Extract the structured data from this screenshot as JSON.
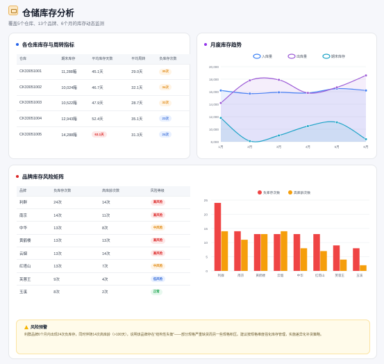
{
  "header": {
    "title": "仓储库存分析",
    "subtitle": "覆盖5个仓库、13个品牌、6个月的库存动态监测"
  },
  "warehouse_card": {
    "title": "各仓库库存与周转指标",
    "dot_color": "#2563eb",
    "columns": [
      "仓库",
      "期末库存",
      "平均库存天数",
      "平均周转",
      "负库存次数"
    ],
    "rows": [
      {
        "name": "CK33051001",
        "stock": "11,288箱",
        "days": "45.1天",
        "turn": "29.0天",
        "neg": "30次",
        "neg_style": "orange",
        "days_hl": false
      },
      {
        "name": "CK33051002",
        "stock": "10,024箱",
        "days": "46.7天",
        "turn": "32.1天",
        "neg": "34次",
        "neg_style": "orange",
        "days_hl": false
      },
      {
        "name": "CK33051003",
        "stock": "10,522箱",
        "days": "47.9天",
        "turn": "28.7天",
        "neg": "32次",
        "neg_style": "orange",
        "days_hl": false
      },
      {
        "name": "CK33051004",
        "stock": "12,943箱",
        "days": "52.4天",
        "turn": "35.1天",
        "neg": "23次",
        "neg_style": "blue",
        "days_hl": false
      },
      {
        "name": "CK33051005",
        "stock": "14,288箱",
        "days": "63.1天",
        "turn": "31.3天",
        "neg": "24次",
        "neg_style": "blue",
        "days_hl": true
      }
    ]
  },
  "trend_card": {
    "title": "月度库存趋势",
    "dot_color": "#9333ea",
    "chart_data": {
      "type": "line",
      "x": [
        "1月",
        "2月",
        "3月",
        "4月",
        "5月",
        "6月"
      ],
      "ylim": [
        8000,
        20000
      ],
      "yticks": [
        "20,000",
        "18,000",
        "16,000",
        "14,000",
        "12,000",
        "10,000",
        "8,000"
      ],
      "legend_position": "top",
      "series": [
        {
          "name": "入库量",
          "values": [
            16200,
            15700,
            15900,
            15800,
            16500,
            16200
          ],
          "color": "#3b82f6"
        },
        {
          "name": "出库量",
          "values": [
            14200,
            17800,
            17900,
            15800,
            16700,
            18600
          ],
          "color": "#9b59d6"
        },
        {
          "name": "期末库存",
          "values": [
            11800,
            8100,
            9000,
            10500,
            11100,
            8400
          ],
          "color": "#1aa3c6"
        }
      ]
    }
  },
  "brand_card": {
    "title": "品牌库存风险矩阵",
    "dot_color": "#dc2626",
    "columns": [
      "品牌",
      "负库存次数",
      "高库龄次数",
      "风险等级"
    ],
    "rows": [
      {
        "name": "利群",
        "neg": "24次",
        "age": "14次",
        "risk": "高风险",
        "risk_style": "red"
      },
      {
        "name": "南京",
        "neg": "14次",
        "age": "11次",
        "risk": "高风险",
        "risk_style": "red"
      },
      {
        "name": "中华",
        "neg": "13次",
        "age": "8次",
        "risk": "中风险",
        "risk_style": "orange"
      },
      {
        "name": "黄鹤楼",
        "neg": "13次",
        "age": "13次",
        "risk": "高风险",
        "risk_style": "red"
      },
      {
        "name": "云烟",
        "neg": "13次",
        "age": "14次",
        "risk": "高风险",
        "risk_style": "red"
      },
      {
        "name": "红塔山",
        "neg": "13次",
        "age": "7次",
        "risk": "中风险",
        "risk_style": "orange"
      },
      {
        "name": "芙蓉王",
        "neg": "9次",
        "age": "4次",
        "risk": "低风险",
        "risk_style": "blue"
      },
      {
        "name": "玉溪",
        "neg": "8次",
        "age": "2次",
        "risk": "正常",
        "risk_style": "green"
      }
    ],
    "chart_data": {
      "type": "bar",
      "categories": [
        "利群",
        "南京",
        "黄鹤楼",
        "云烟",
        "中华",
        "红塔山",
        "芙蓉王",
        "玉溪"
      ],
      "ylim": [
        0,
        25
      ],
      "yticks": [
        "25",
        "20",
        "15",
        "10",
        "5",
        "0"
      ],
      "legend_position": "top",
      "series": [
        {
          "name": "负库存次数",
          "values": [
            24,
            14,
            13,
            13,
            13,
            13,
            9,
            8
          ],
          "color": "#ef4444"
        },
        {
          "name": "高库龄次数",
          "values": [
            14,
            11,
            13,
            14,
            8,
            7,
            4,
            2
          ],
          "color": "#f59e0b"
        }
      ]
    },
    "warning": {
      "title": "风险预警",
      "text": "利群品牌6个月内出现24次负库存，同时伴随14次高库龄（>100天），说明该品牌存在“结构性失衡”——部分规格严重缺货而另一些规格积压。建议按规格维度强化库存管理，实施差异化补货策略。"
    }
  }
}
